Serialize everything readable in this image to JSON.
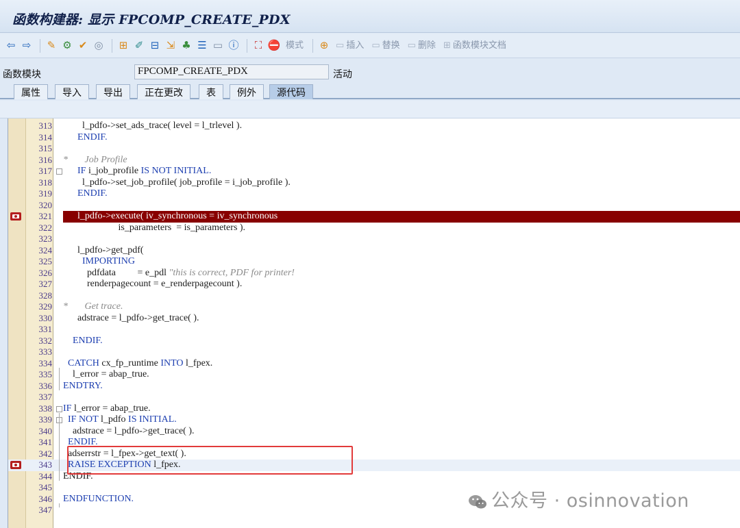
{
  "window": {
    "title": "函数构建器: 显示 FPCOMP_CREATE_PDX"
  },
  "toolbar": {
    "icons": [
      "back-arrow-icon",
      "forward-arrow-icon",
      "display-change-icon",
      "other-object-icon",
      "activate-icon",
      "where-used-icon",
      "object-list-icon",
      "pattern-icon",
      "test-icon",
      "navigate-icon",
      "hierarchy-icon",
      "display-object-list-icon",
      "enhance-icon",
      "info-icon",
      "debug-icon",
      "breakpoint-icon"
    ],
    "mode_label": "模式",
    "insert_label": "插入",
    "replace_label": "替换",
    "delete_label": "删除",
    "doc_label": "函数模块文档"
  },
  "header": {
    "label": "函数模块",
    "value": "FPCOMP_CREATE_PDX",
    "status": "活动"
  },
  "tabs": [
    "属性",
    "导入",
    "导出",
    "正在更改",
    "表",
    "例外",
    "源代码"
  ],
  "active_tab": "源代码",
  "editor": {
    "lines": [
      {
        "n": "313",
        "segs": [
          [
            "        l_pdfo->set_ads_trace( level = l_trlevel ).",
            ""
          ]
        ]
      },
      {
        "n": "314",
        "segs": [
          [
            "      ENDIF.",
            "kw"
          ]
        ]
      },
      {
        "n": "315",
        "segs": []
      },
      {
        "n": "316",
        "segs": [
          [
            "*",
            "cm"
          ],
          [
            "       Job Profile",
            "cm"
          ]
        ]
      },
      {
        "n": "317",
        "segs": [
          [
            "      ",
            ""
          ],
          [
            "IF",
            "kw"
          ],
          [
            " i_job_profile ",
            ""
          ],
          [
            "IS NOT INITIAL.",
            "kw"
          ]
        ]
      },
      {
        "n": "318",
        "segs": [
          [
            "        l_pdfo->set_job_profile( job_profile = i_job_profile ).",
            ""
          ]
        ]
      },
      {
        "n": "319",
        "segs": [
          [
            "      ENDIF.",
            "kw"
          ]
        ]
      },
      {
        "n": "320",
        "segs": []
      },
      {
        "n": "321",
        "segs": [
          [
            "      l_pdfo->execute( iv_synchronous = iv_synchronous",
            ""
          ]
        ]
      },
      {
        "n": "322",
        "segs": [
          [
            "                       is_parameters  = is_parameters ).",
            ""
          ]
        ]
      },
      {
        "n": "323",
        "segs": []
      },
      {
        "n": "324",
        "segs": [
          [
            "      l_pdfo->get_pdf(",
            ""
          ]
        ]
      },
      {
        "n": "325",
        "segs": [
          [
            "        IMPORTING",
            "kw"
          ]
        ]
      },
      {
        "n": "326",
        "segs": [
          [
            "          pdfdata         = e_pdl ",
            ""
          ],
          [
            "\"this is correct, PDF for printer!",
            "st"
          ]
        ]
      },
      {
        "n": "327",
        "segs": [
          [
            "          renderpagecount = e_renderpagecount ).",
            ""
          ]
        ]
      },
      {
        "n": "328",
        "segs": []
      },
      {
        "n": "329",
        "segs": [
          [
            "*",
            "cm"
          ],
          [
            "       Get trace.",
            "cm"
          ]
        ]
      },
      {
        "n": "330",
        "segs": [
          [
            "      adstrace = l_pdfo->get_trace( ).",
            ""
          ]
        ]
      },
      {
        "n": "331",
        "segs": []
      },
      {
        "n": "332",
        "segs": [
          [
            "    ENDIF.",
            "kw"
          ]
        ]
      },
      {
        "n": "333",
        "segs": []
      },
      {
        "n": "334",
        "segs": [
          [
            "  ",
            ""
          ],
          [
            "CATCH",
            "kw"
          ],
          [
            " cx_fp_runtime ",
            ""
          ],
          [
            "INTO",
            "kw"
          ],
          [
            " l_fpex.",
            ""
          ]
        ]
      },
      {
        "n": "335",
        "segs": [
          [
            "    l_error = abap_true.",
            ""
          ]
        ]
      },
      {
        "n": "336",
        "segs": [
          [
            "ENDTRY.",
            "kw"
          ]
        ]
      },
      {
        "n": "337",
        "segs": []
      },
      {
        "n": "338",
        "segs": [
          [
            "IF",
            "kw"
          ],
          [
            " l_error = abap_true.",
            ""
          ]
        ]
      },
      {
        "n": "339",
        "segs": [
          [
            "  ",
            ""
          ],
          [
            "IF NOT",
            "kw"
          ],
          [
            " l_pdfo ",
            ""
          ],
          [
            "IS INITIAL.",
            "kw"
          ]
        ]
      },
      {
        "n": "340",
        "segs": [
          [
            "    adstrace = l_pdfo->get_trace( ).",
            ""
          ]
        ]
      },
      {
        "n": "341",
        "segs": [
          [
            "  ENDIF.",
            "kw"
          ]
        ]
      },
      {
        "n": "342",
        "segs": [
          [
            "  adserrstr = l_fpex->get_text( ).",
            ""
          ]
        ]
      },
      {
        "n": "343",
        "segs": [
          [
            "  ",
            ""
          ],
          [
            "RAISE EXCEPTION",
            "kw"
          ],
          [
            " l_fpex.",
            ""
          ]
        ]
      },
      {
        "n": "344",
        "segs": [
          [
            "ENDIF.",
            ""
          ]
        ]
      },
      {
        "n": "345",
        "segs": []
      },
      {
        "n": "346",
        "segs": [
          [
            "ENDFUNCTION.",
            "kw"
          ]
        ]
      },
      {
        "n": "347",
        "segs": []
      }
    ]
  },
  "watermark": {
    "text": "公众号 · osinnovation"
  }
}
